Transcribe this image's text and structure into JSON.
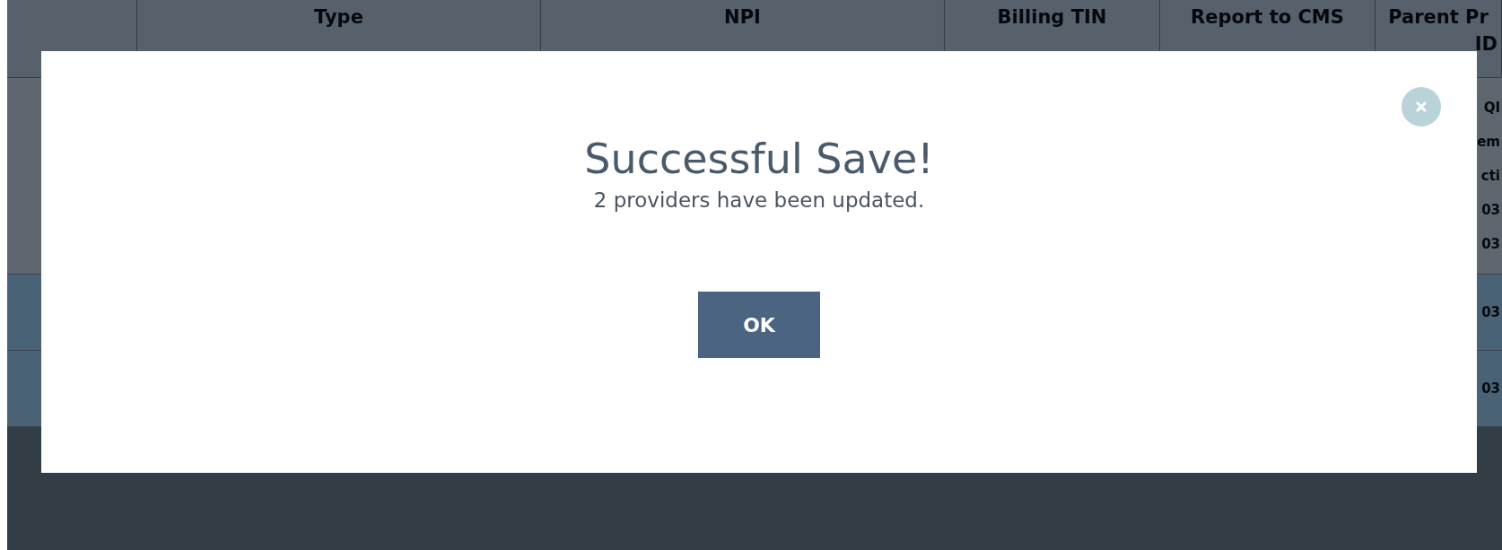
{
  "table": {
    "columns": [
      {
        "lines": [
          "Type"
        ]
      },
      {
        "lines": [
          "NPI"
        ]
      },
      {
        "lines": [
          "Billing TIN"
        ]
      },
      {
        "lines": [
          "Report to CMS"
        ]
      },
      {
        "lines": [
          "Parent Pr",
          "ID"
        ]
      }
    ],
    "rows": [
      {
        "selected": false,
        "lines": [
          "QI",
          "em",
          "cti",
          "03",
          "03"
        ]
      },
      {
        "selected": true,
        "lines": [
          "03"
        ]
      },
      {
        "selected": true,
        "lines": [
          "03"
        ]
      }
    ]
  },
  "dialog": {
    "title": "Successful Save!",
    "message": "2 providers have been updated.",
    "button": "OK"
  }
}
